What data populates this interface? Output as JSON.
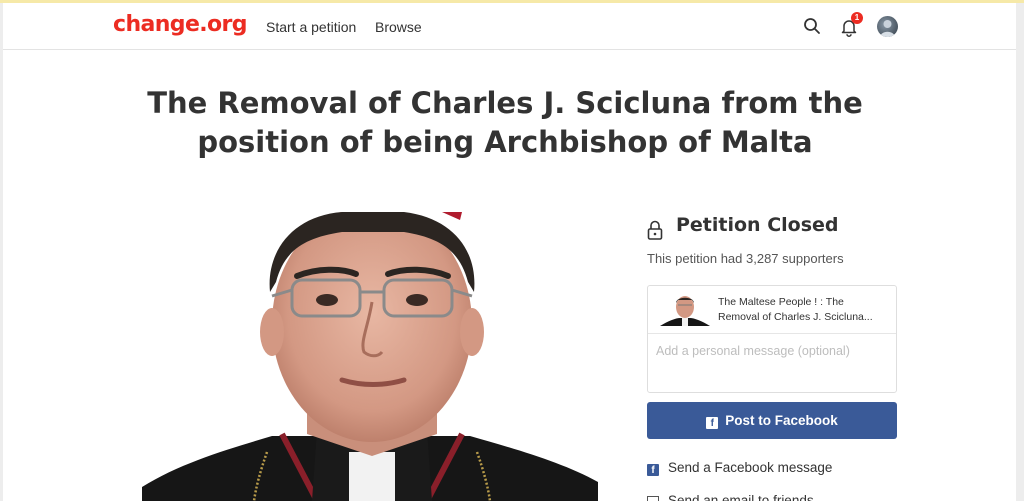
{
  "header": {
    "logo": "change.org",
    "nav": {
      "start_petition": "Start a petition",
      "browse": "Browse"
    },
    "notification_count": "1"
  },
  "petition": {
    "title": "The Removal of Charles J. Scicluna from the position of being Archbishop of Malta"
  },
  "status": {
    "title": "Petition Closed",
    "supporters_text": "This petition had 3,287 supporters"
  },
  "share": {
    "preview_text": "The Maltese People ! : The Removal of Charles J. Scicluna...",
    "message_placeholder": "Add a personal message (optional)",
    "facebook_button": "Post to Facebook",
    "facebook_message": "Send a Facebook message",
    "email_friends": "Send an email to friends"
  },
  "colors": {
    "brand": "#ec2c22",
    "facebook": "#3a5a98"
  },
  "icons": {
    "search": "search-icon",
    "bell": "bell-icon",
    "lock": "lock-icon",
    "facebook": "facebook-icon",
    "mail": "mail-icon"
  }
}
